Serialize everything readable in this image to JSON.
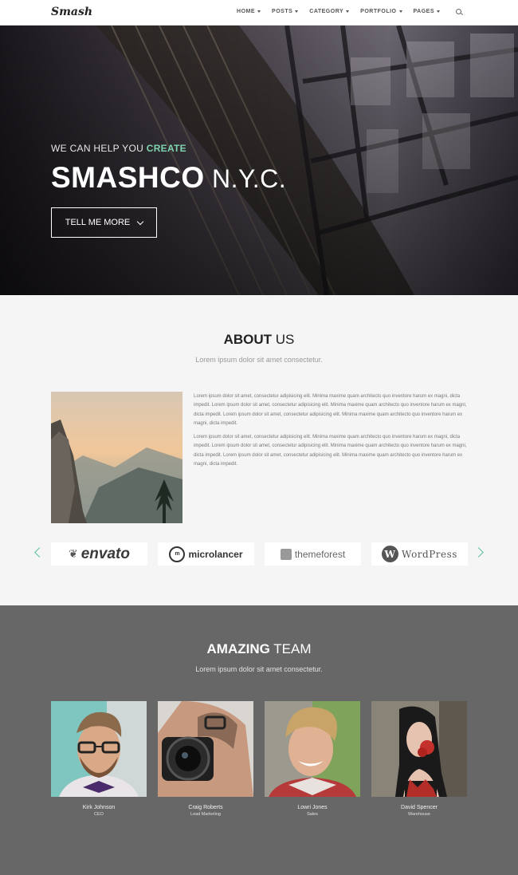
{
  "site": {
    "logo": "Smash"
  },
  "nav": {
    "items": [
      {
        "label": "HOME"
      },
      {
        "label": "POSTS"
      },
      {
        "label": "CATEGORY"
      },
      {
        "label": "PORTFOLIO"
      },
      {
        "label": "PAGES"
      }
    ],
    "search_icon": "search-icon"
  },
  "hero": {
    "subtitle_prefix": "WE CAN HELP YOU ",
    "subtitle_accent": "CREATE",
    "title_bold": "SMASHCO",
    "title_light": " N.Y.C.",
    "button_label": "TELL ME MORE",
    "accent_color": "#7fd3b0"
  },
  "about": {
    "title_bold": "ABOUT",
    "title_light": " US",
    "subtitle": "Lorem ipsum dolor sit amet consectetur.",
    "paragraphs": [
      "Lorem ipsum dolor sit amet, consectetur adipisicing elit. Minima maxime quam architecto quo inventore harum ex magni, dicta impedit. Lorem ipsum dolor sit amet, consectetur adipisicing elit. Minima maxime quam architecto quo inventore harum ex magni, dicta impedit. Lorem ipsum dolor sit amet, consectetur adipisicing elit. Minima maxime quam architecto quo inventore harum ex magni, dicta impedit.",
      "Lorem ipsum dolor sit amet, consectetur adipisicing elit. Minima maxime quam architecto quo inventore harum ex magni, dicta impedit. Lorem ipsum dolor sit amet, consectetur adipisicing elit. Minima maxime quam architecto quo inventore harum ex magni, dicta impedit. Lorem ipsum dolor sit amet, consectetur adipisicing elit. Minima maxime quam architecto quo inventore harum ex magni, dicta impedit."
    ]
  },
  "partners": [
    {
      "name": "envato"
    },
    {
      "name": "microlancer",
      "badge": "m"
    },
    {
      "name": "themeforest"
    },
    {
      "name": "WordPress",
      "badge": "W"
    }
  ],
  "team": {
    "title_bold": "AMAZING",
    "title_light": " TEAM",
    "subtitle": "Lorem ipsum dolor sit amet consectetur.",
    "members": [
      {
        "name": "Kirk Johnson",
        "role": "CEO"
      },
      {
        "name": "Craig Roberts",
        "role": "Lead Marketing"
      },
      {
        "name": "Lowri Jones",
        "role": "Sales"
      },
      {
        "name": "David Spencer",
        "role": "Warehouse"
      }
    ]
  }
}
